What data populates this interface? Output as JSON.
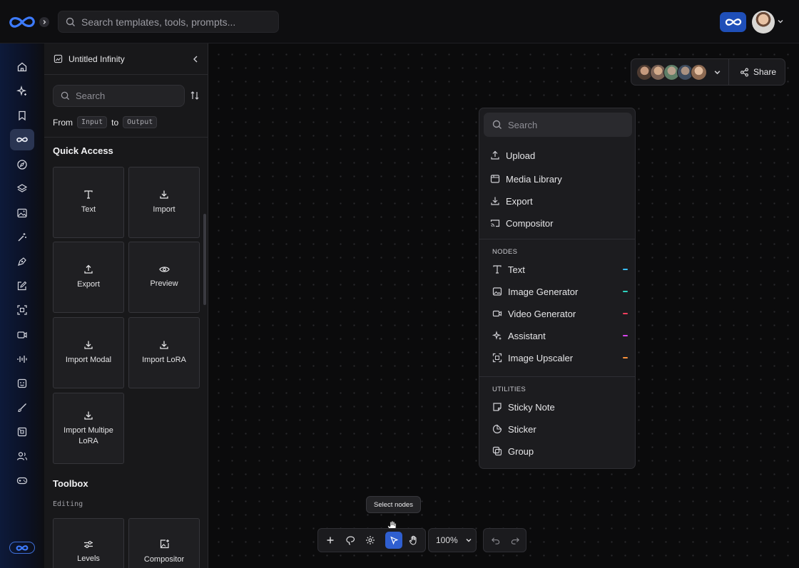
{
  "topbar": {
    "search_placeholder": "Search templates, tools, prompts..."
  },
  "rail": {
    "items": [
      "home-icon",
      "sparkles-icon",
      "bookmark-icon",
      "infinity-icon",
      "compass-icon",
      "layers-icon",
      "image-icon",
      "magic-wand-icon",
      "pen-tool-icon",
      "edit-icon",
      "crop-icon",
      "video-icon",
      "audio-wave-icon",
      "assistant-icon",
      "brush-icon",
      "3d-icon",
      "users-icon",
      "gamepad-icon"
    ],
    "active": "infinity-icon"
  },
  "panel": {
    "title": "Untitled Infinity",
    "search_placeholder": "Search",
    "from_label": "From",
    "input_chip": "Input",
    "to_label": "to",
    "output_chip": "Output",
    "quick_access_title": "Quick Access",
    "quick_access": [
      {
        "label": "Text",
        "icon": "text-icon"
      },
      {
        "label": "Import",
        "icon": "download-icon"
      },
      {
        "label": "Export",
        "icon": "upload-icon"
      },
      {
        "label": "Preview",
        "icon": "eye-icon"
      },
      {
        "label": "Import Modal",
        "icon": "download-icon"
      },
      {
        "label": "Import LoRA",
        "icon": "download-icon"
      },
      {
        "label": "Import Multipe LoRA",
        "icon": "download-icon"
      }
    ],
    "toolbox_title": "Toolbox",
    "editing_label": "Editing",
    "toolbox": [
      {
        "label": "Levels",
        "icon": "sliders-icon"
      },
      {
        "label": "Compositor",
        "icon": "image-plus-icon"
      }
    ]
  },
  "collab": {
    "share_label": "Share",
    "faces": [
      "#8a6a58",
      "#b58b6e",
      "#6e8a78",
      "#5a6a80",
      "#c49a7c"
    ]
  },
  "menu": {
    "search_placeholder": "Search",
    "actions": [
      {
        "label": "Upload",
        "icon": "upload-icon"
      },
      {
        "label": "Media Library",
        "icon": "media-library-icon"
      },
      {
        "label": "Export",
        "icon": "download-icon"
      },
      {
        "label": "Compositor",
        "icon": "cast-icon"
      }
    ],
    "nodes_heading": "NODES",
    "nodes": [
      {
        "label": "Text",
        "icon": "text-icon",
        "color": "#38bdf8"
      },
      {
        "label": "Image Generator",
        "icon": "image-icon",
        "color": "#2dd4bf"
      },
      {
        "label": "Video Generator",
        "icon": "video-icon",
        "color": "#f43f5e"
      },
      {
        "label": "Assistant",
        "icon": "sparkles-icon",
        "color": "#d946ef"
      },
      {
        "label": "Image Upscaler",
        "icon": "upscale-icon",
        "color": "#fb923c"
      }
    ],
    "utilities_heading": "UTILITIES",
    "utilities": [
      {
        "label": "Sticky Note",
        "icon": "sticky-note-icon"
      },
      {
        "label": "Sticker",
        "icon": "sticker-icon"
      },
      {
        "label": "Group",
        "icon": "group-icon"
      }
    ]
  },
  "toolbar": {
    "tooltip": "Select nodes",
    "zoom": "100%"
  },
  "colors": {
    "accent": "#2f5fd0",
    "brand": "#1f4fb8",
    "background": "#0b0b0c"
  }
}
